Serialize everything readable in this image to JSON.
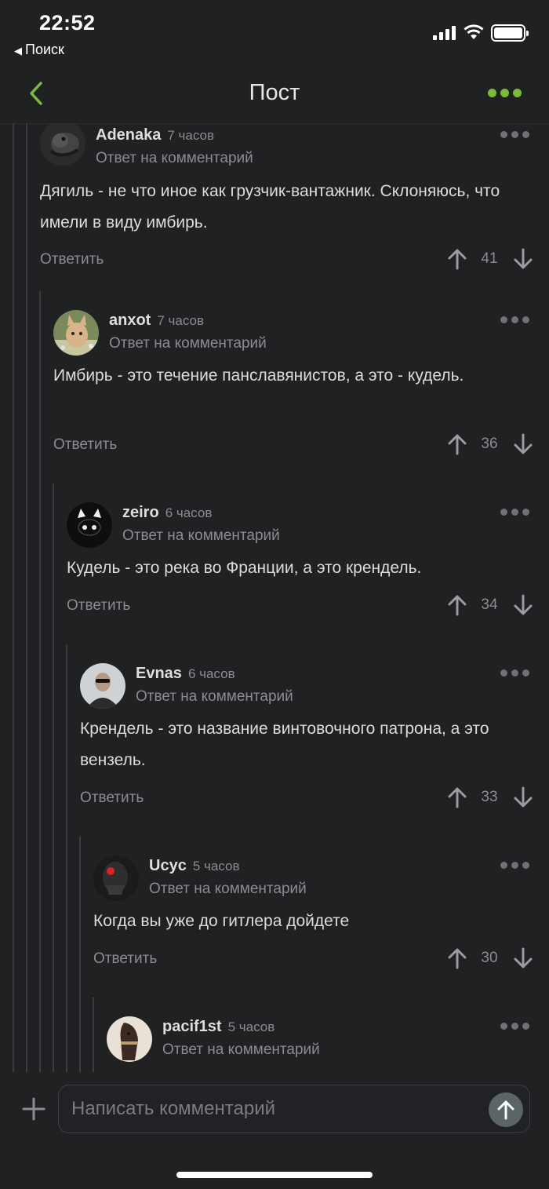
{
  "status_bar": {
    "time": "22:52",
    "back_app": "Поиск"
  },
  "nav": {
    "title": "Пост"
  },
  "comments": [
    {
      "author": "Adenaka",
      "time": "7 часов",
      "reply_to": "Ответ на комментарий",
      "body": "Дягиль - не что иное как грузчик-вантажник. Склоняюсь, что имели в виду имбирь.",
      "reply_label": "Ответить",
      "score": "41"
    },
    {
      "author": "anxot",
      "time": "7 часов",
      "reply_to": "Ответ на комментарий",
      "body": "Имбирь - это течение панславянистов, а это - кудель.",
      "reply_label": "Ответить",
      "score": "36"
    },
    {
      "author": "zeiro",
      "time": "6 часов",
      "reply_to": "Ответ на комментарий",
      "body": "Кудель - это река во Франции, а это крендель.",
      "reply_label": "Ответить",
      "score": "34"
    },
    {
      "author": "Evnas",
      "time": "6 часов",
      "reply_to": "Ответ на комментарий",
      "body": "Крендель - это название винтовочного патрона, а это вензель.",
      "reply_label": "Ответить",
      "score": "33"
    },
    {
      "author": "Ucyc",
      "time": "5 часов",
      "reply_to": "Ответ на комментарий",
      "body": "Когда вы уже до гитлера дойдете",
      "reply_label": "Ответить",
      "score": "30"
    },
    {
      "author": "pacif1st",
      "time": "5 часов",
      "reply_to": "Ответ на комментарий"
    }
  ],
  "composer": {
    "placeholder": "Написать комментарий"
  },
  "colors": {
    "accent": "#7cbb3c",
    "background": "#1f2123",
    "muted": "#8a8c8f",
    "send_button": "#5b6568"
  }
}
